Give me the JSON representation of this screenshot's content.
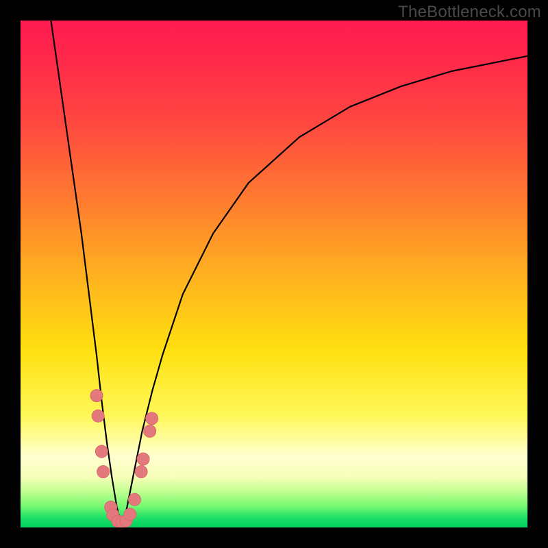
{
  "watermark": "TheBottleneck.com",
  "colors": {
    "frame": "#000000",
    "curve_stroke": "#000000",
    "marker_fill": "#e4797d",
    "marker_stroke": "#d86a6e"
  },
  "chart_data": {
    "type": "line",
    "title": "",
    "xlabel": "",
    "ylabel": "",
    "xlim": [
      0,
      100
    ],
    "ylim": [
      0,
      100
    ],
    "note": "V-shaped bottleneck curve. X axis: component performance index (0–100). Y axis: bottleneck percentage (0–100, 0 at bottom/green, 100 at top/red). Curve minimum (optimal match, 0% bottleneck) occurs at x≈20.",
    "series": [
      {
        "name": "bottleneck_curve",
        "x": [
          6,
          8,
          10,
          12,
          14,
          15,
          16,
          17,
          18,
          19,
          20,
          21,
          22,
          23,
          24,
          26,
          28,
          32,
          38,
          45,
          55,
          65,
          75,
          85,
          95,
          100
        ],
        "y": [
          100,
          86,
          72,
          58,
          42,
          34,
          25,
          17,
          10,
          4,
          0,
          4,
          9,
          14,
          19,
          27,
          34,
          46,
          58,
          68,
          77,
          83,
          87,
          90,
          92,
          93
        ]
      }
    ],
    "markers": {
      "name": "highlighted_points",
      "note": "Coral dot markers clustered along both sides of the valley near the minimum.",
      "points": [
        {
          "x": 15.0,
          "y": 26
        },
        {
          "x": 15.3,
          "y": 22
        },
        {
          "x": 16.0,
          "y": 15
        },
        {
          "x": 16.3,
          "y": 11
        },
        {
          "x": 17.8,
          "y": 4
        },
        {
          "x": 18.2,
          "y": 2.5
        },
        {
          "x": 19.2,
          "y": 1.2
        },
        {
          "x": 20.0,
          "y": 1.0
        },
        {
          "x": 20.8,
          "y": 1.3
        },
        {
          "x": 21.6,
          "y": 2.6
        },
        {
          "x": 22.5,
          "y": 5.5
        },
        {
          "x": 23.8,
          "y": 11
        },
        {
          "x": 24.2,
          "y": 13.5
        },
        {
          "x": 25.5,
          "y": 19
        },
        {
          "x": 25.9,
          "y": 21.5
        }
      ]
    }
  }
}
